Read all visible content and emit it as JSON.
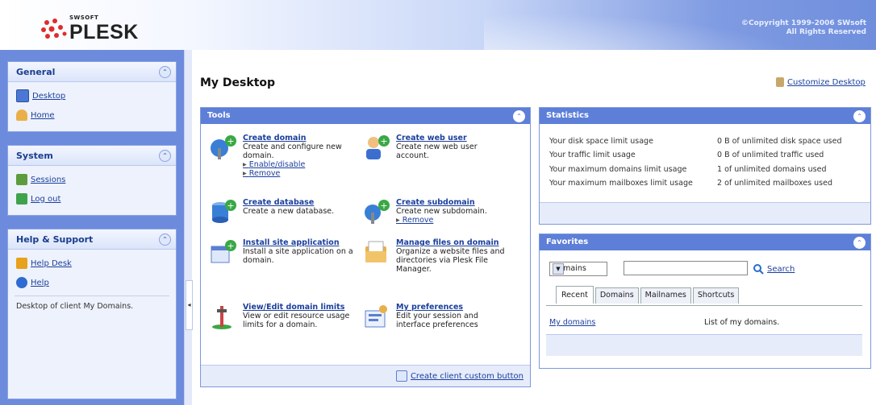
{
  "brand": {
    "vendor": "SWSOFT",
    "product": "PLESK",
    "copyright_line1": "©Copyright 1999-2006 SWsoft",
    "copyright_line2": "All Rights Reserved"
  },
  "sidebar": {
    "general": {
      "title": "General",
      "items": [
        {
          "label": "Desktop",
          "icon": "desktop-icon"
        },
        {
          "label": "Home",
          "icon": "home-icon"
        }
      ]
    },
    "system": {
      "title": "System",
      "items": [
        {
          "label": "Sessions",
          "icon": "sessions-icon"
        },
        {
          "label": "Log out",
          "icon": "logout-icon"
        }
      ]
    },
    "help": {
      "title": "Help & Support",
      "items": [
        {
          "label": "Help Desk",
          "icon": "helpdesk-icon"
        },
        {
          "label": "Help",
          "icon": "help-icon"
        }
      ],
      "context_text": "Desktop of client My Domains."
    }
  },
  "main": {
    "title": "My Desktop",
    "customize_label": "Customize Desktop",
    "tools": {
      "title": "Tools",
      "items": [
        {
          "title": "Create domain",
          "desc": "Create and configure new domain.",
          "links": [
            "Enable/disable",
            "Remove"
          ]
        },
        {
          "title": "Create web user",
          "desc": "Create new web user account.",
          "links": []
        },
        {
          "title": "Create database",
          "desc": "Create a new database.",
          "links": []
        },
        {
          "title": "Create subdomain",
          "desc": "Create new subdomain.",
          "links": [
            "Remove"
          ]
        },
        {
          "title": "Install site application",
          "desc": "Install a site application on a domain.",
          "links": []
        },
        {
          "title": "Manage files on domain",
          "desc": "Organize a website files and directories via Plesk File Manager.",
          "links": []
        },
        {
          "title": "View/Edit domain limits",
          "desc": "View or edit resource usage limits for a domain.",
          "links": []
        },
        {
          "title": "My preferences",
          "desc": "Edit your session and interface preferences",
          "links": []
        }
      ],
      "footer_label": "Create client custom button"
    },
    "statistics": {
      "title": "Statistics",
      "rows": [
        {
          "label": "Your disk space limit usage",
          "value": "0 B of unlimited disk space used"
        },
        {
          "label": "Your traffic limit usage",
          "value": "0 B of unlimited traffic used"
        },
        {
          "label": "Your maximum domains limit usage",
          "value": "1 of unlimited domains used"
        },
        {
          "label": "Your maximum mailboxes limit usage",
          "value": "2 of unlimited mailboxes used"
        }
      ]
    },
    "favorites": {
      "title": "Favorites",
      "scope_select": "Domains",
      "search_value": "",
      "search_label": "Search",
      "tabs": [
        "Recent",
        "Domains",
        "Mailnames",
        "Shortcuts"
      ],
      "active_tab": "Recent",
      "rows": [
        {
          "link": "My domains",
          "desc": "List of my domains."
        }
      ]
    }
  }
}
